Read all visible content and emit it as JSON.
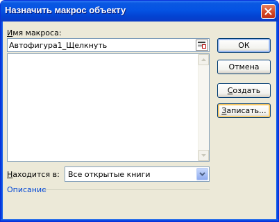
{
  "dialog": {
    "title": "Назначить макрос объекту"
  },
  "macro_name": {
    "label": "Имя макроса:",
    "label_underline": "И",
    "label_rest": "мя макроса:",
    "value": "Автофигура1_Щелкнуть"
  },
  "macro_list": {
    "items": []
  },
  "location": {
    "label_underline": "Н",
    "label_rest": "аходится в:",
    "selected": "Все открытые книги"
  },
  "description": {
    "label": "Описание"
  },
  "buttons": {
    "ok": "ОК",
    "cancel": "Отмена",
    "create_underline": "С",
    "create_rest": "оздать",
    "record_underline": "З",
    "record_rest": "аписать..."
  },
  "colors": {
    "title_bar": "#0553e3",
    "dialog_bg": "#ece9d8",
    "close_button": "#d24422",
    "description_label": "#0046d5"
  }
}
